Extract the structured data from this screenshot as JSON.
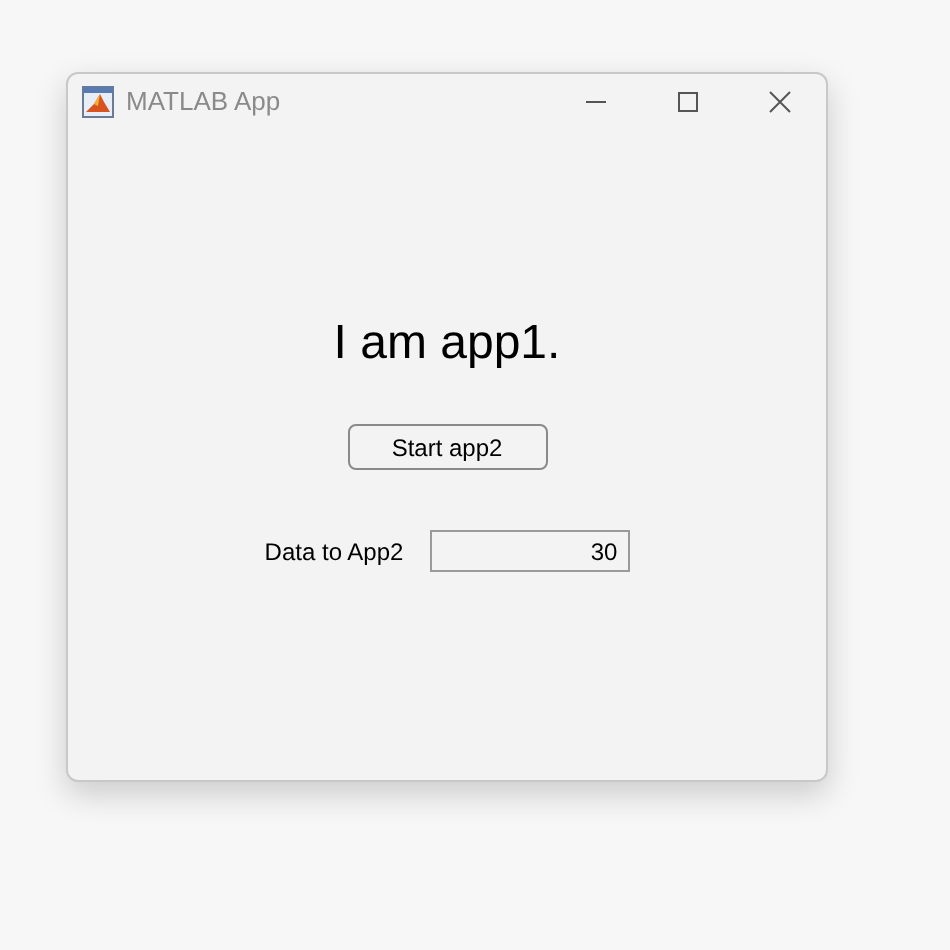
{
  "window": {
    "title": "MATLAB App"
  },
  "heading": "I am app1.",
  "button": "Start app2",
  "field": {
    "label": "Data to App2",
    "value": "30"
  }
}
